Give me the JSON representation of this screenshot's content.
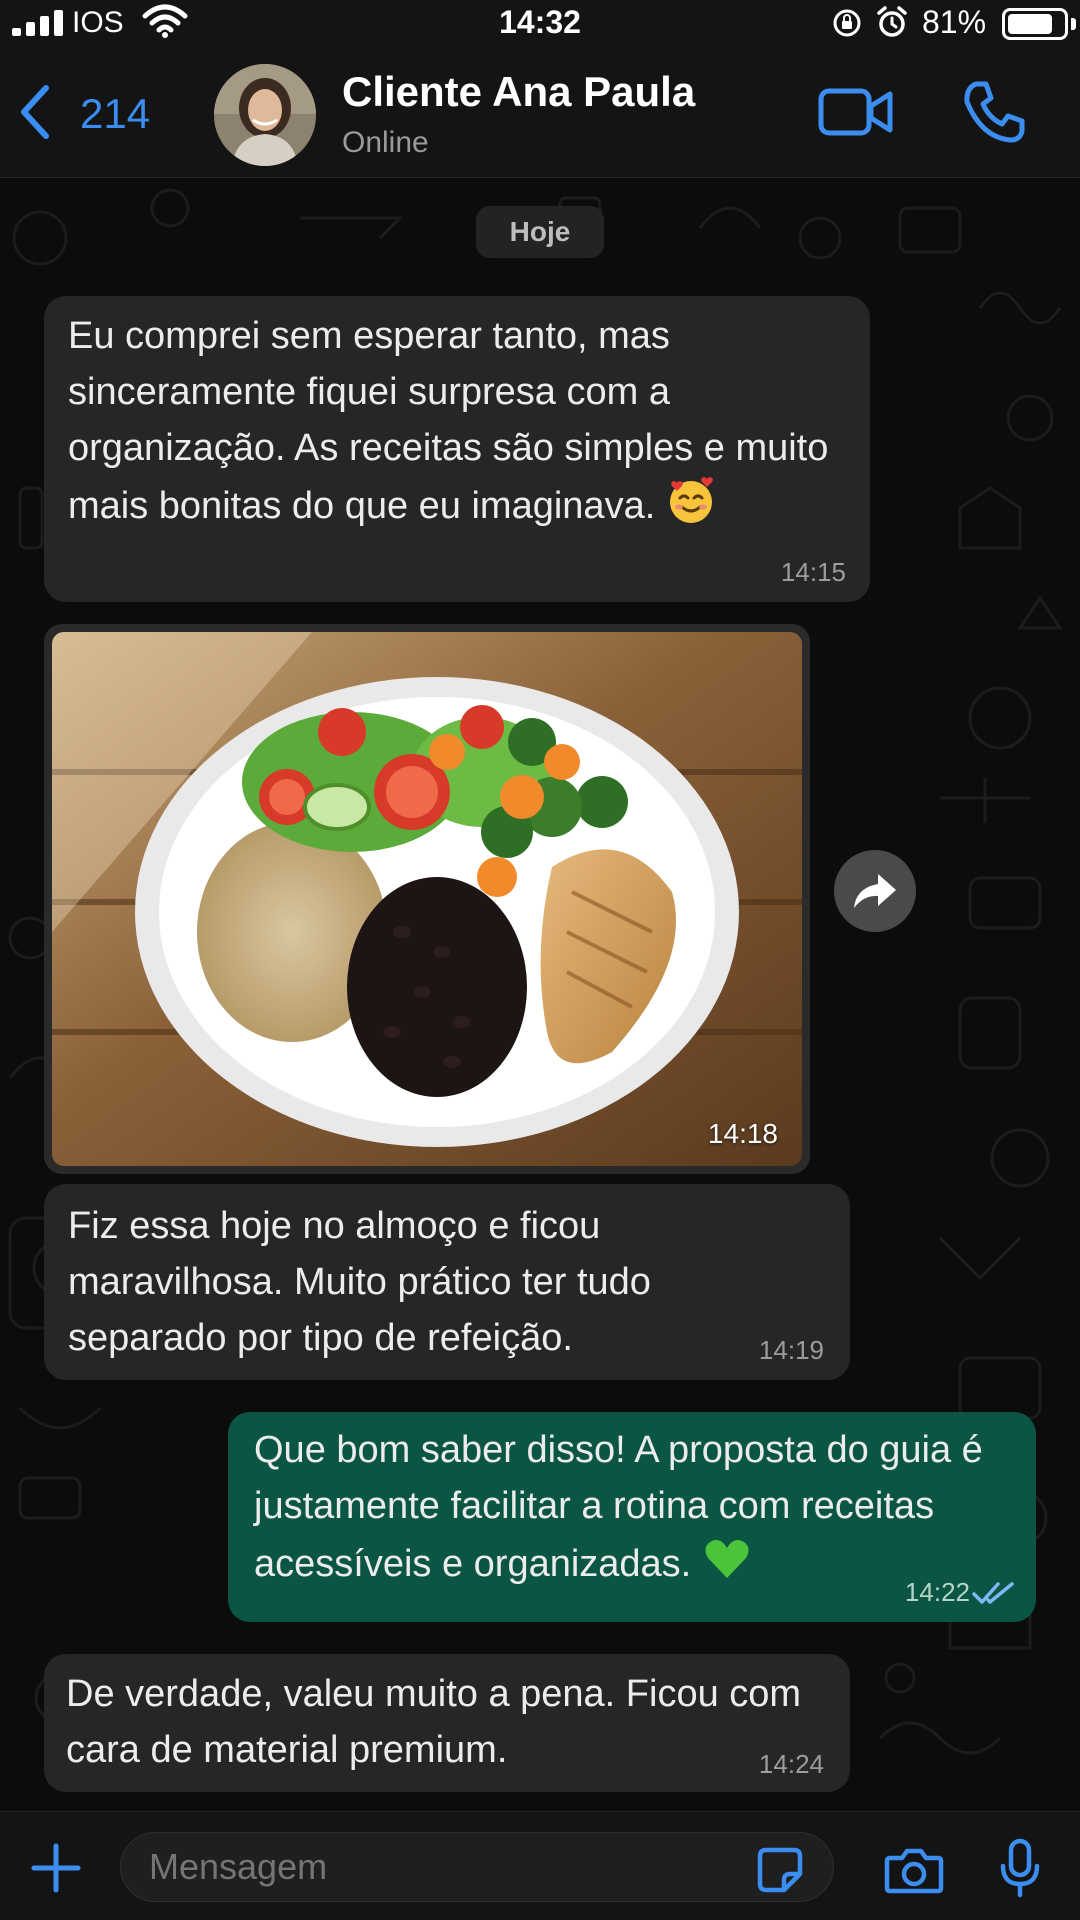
{
  "status_bar": {
    "carrier": "IOS",
    "time": "14:32",
    "battery_percent": "81%",
    "battery_level": 0.81
  },
  "header": {
    "back_count": "214",
    "contact_name": "Cliente Ana Paula",
    "contact_status": "Online"
  },
  "chat": {
    "date_chip": "Hoje",
    "messages": [
      {
        "direction": "in",
        "text": "Eu comprei sem esperar tanto, mas sinceramente fiquei surpresa com a organização. As receitas são simples e muito mais bonitas do que eu imaginava.",
        "emoji": "smiling-face-with-hearts",
        "time": "14:15"
      },
      {
        "direction": "in",
        "type": "image",
        "image_subject": "plate-with-salad-rice-beans-chicken",
        "time": "14:18"
      },
      {
        "direction": "in",
        "text": "Fiz essa hoje no almoço e ficou maravilhosa. Muito prático ter tudo separado por tipo de refeição.",
        "time": "14:19"
      },
      {
        "direction": "out",
        "text": "Que bom saber disso! A proposta do guia é justamente facilitar a rotina com receitas acessíveis e organizadas.",
        "emoji": "green-heart",
        "time": "14:22",
        "read_receipt": "double-check"
      },
      {
        "direction": "in",
        "text": "De verdade, valeu muito a pena. Ficou com cara de material premium.",
        "time": "14:24"
      }
    ]
  },
  "composer": {
    "placeholder": "Mensagem"
  },
  "colors": {
    "accent": "#3b8ef0",
    "incoming_bubble": "#262626",
    "outgoing_bubble": "#0a5544",
    "background": "#0c0c0c"
  }
}
